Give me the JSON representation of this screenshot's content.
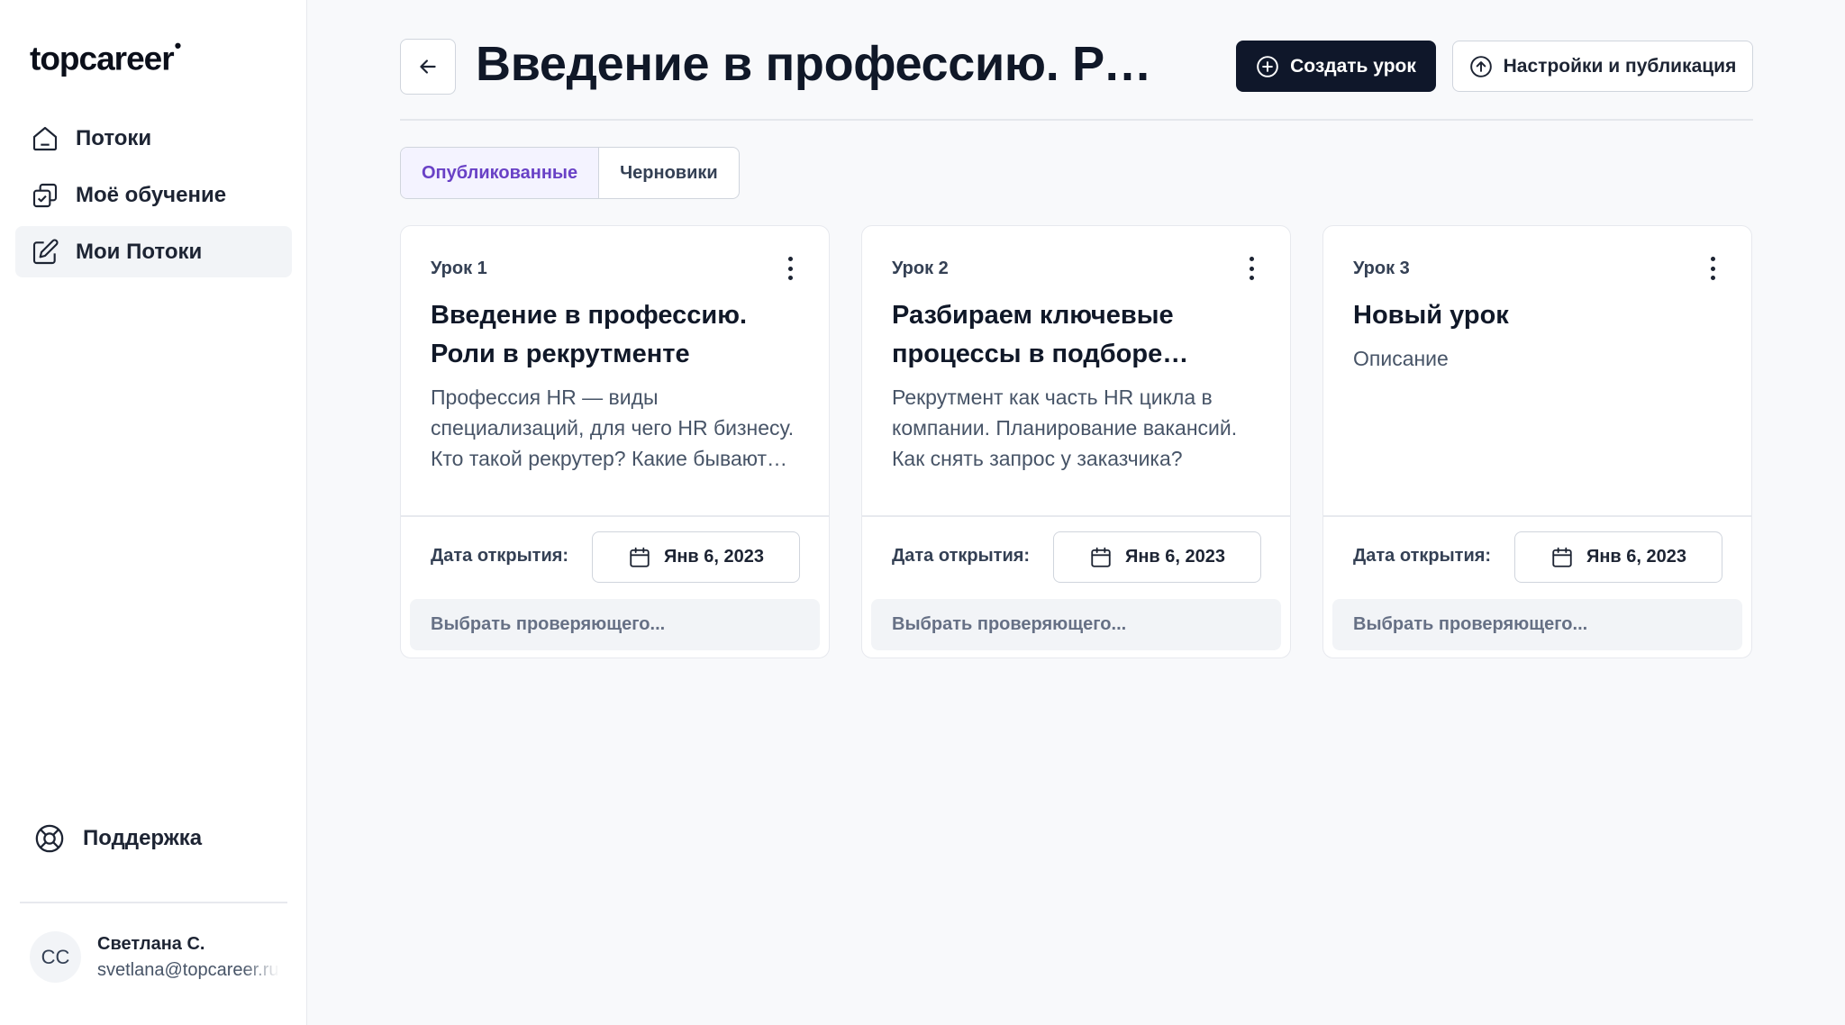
{
  "sidebar": {
    "logo": "topcareer",
    "logo_mark": "•",
    "items": [
      {
        "label": "Потоки",
        "icon": "home-icon"
      },
      {
        "label": "Моё обучение",
        "icon": "copy-check-icon"
      },
      {
        "label": "Мои Потоки",
        "icon": "edit-icon",
        "active": true
      }
    ],
    "support_label": "Поддержка",
    "user": {
      "initials": "СС",
      "name": "Светлана С.",
      "email": "svetlana@topcareer.ru"
    }
  },
  "header": {
    "title": "Введение в профессию. Роли в рекрутменте",
    "create_label": "Создать урок",
    "settings_label": "Настройки и публикация"
  },
  "tabs": [
    {
      "label": "Опубликованные",
      "active": true
    },
    {
      "label": "Черновики",
      "active": false
    }
  ],
  "cards": [
    {
      "number": "Урок 1",
      "title": "Введение в профессию. Роли в рекрутменте",
      "description": "Профессия HR — виды специализаций, для чего HR бизнесу. Кто такой рекрутер? Какие бывают роли",
      "date_label": "Дата открытия:",
      "date": "Янв 6, 2023",
      "reviewer_placeholder": "Выбрать проверяющего..."
    },
    {
      "number": "Урок 2",
      "title": "Разбираем ключевые процессы в подборе персонала",
      "description": "Рекрутмент как часть HR цикла в компании. Планирование вакансий. Как снять запрос у заказчика?",
      "date_label": "Дата открытия:",
      "date": "Янв 6, 2023",
      "reviewer_placeholder": "Выбрать проверяющего..."
    },
    {
      "number": "Урок 3",
      "title": "Новый урок",
      "description": "Описание",
      "date_label": "Дата открытия:",
      "date": "Янв 6, 2023",
      "reviewer_placeholder": "Выбрать проверяющего..."
    }
  ],
  "colors": {
    "primary": "#0f172a",
    "accent": "#6941c6",
    "tab_active_bg": "#f4f3ff",
    "background": "#f8f9fb"
  }
}
